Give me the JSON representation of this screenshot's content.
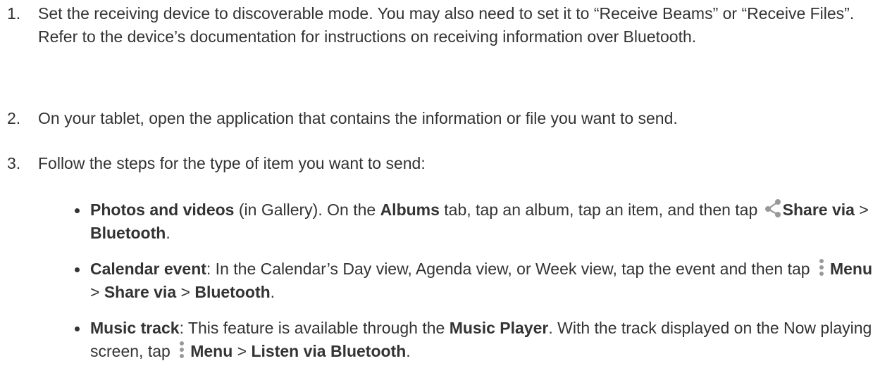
{
  "steps": [
    {
      "number": "1.",
      "text": "Set the receiving device to discoverable mode. You may also need to set it to “Receive Beams” or “Receive Files”. Refer to the device’s documentation for instructions on receiving information over Bluetooth."
    },
    {
      "number": "2.",
      "text": "On your tablet, open the application that contains the information or file you want to send."
    },
    {
      "number": "3.",
      "text": "Follow the steps for the type of item you want to send:"
    }
  ],
  "bullets": [
    {
      "title": "Photos and videos",
      "t1": " (in Gallery). On the ",
      "b1": "Albums",
      "t2": " tab, tap an album, tap an item, and then tap ",
      "b2": "Share via",
      "t3": " > ",
      "b3": "Bluetooth",
      "t4": "."
    },
    {
      "title": "Calendar event",
      "t1": ": In the Calendar’s Day view, Agenda view, or Week view, tap the event and then tap ",
      "b1": "Menu",
      "t2": " > ",
      "b2": "Share via",
      "t3": " > ",
      "b3": "Bluetooth",
      "t4": "."
    },
    {
      "title": "Music track",
      "t1": ": This feature is available through the ",
      "b1": "Music Player",
      "t2": ". With the track displayed on the Now playing screen, tap ",
      "b2": "Menu",
      "t3": " > ",
      "b3": "Listen via Bluetooth",
      "t4": "."
    }
  ],
  "icons": {
    "share": "share-icon",
    "menu": "menu-icon"
  },
  "colors": {
    "text": "#333333",
    "icon": "#999999"
  }
}
